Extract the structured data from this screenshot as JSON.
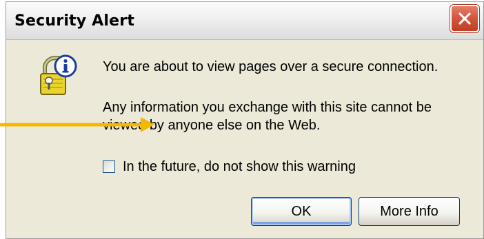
{
  "window": {
    "title": "Security Alert"
  },
  "dialog": {
    "message_primary": "You are about to view pages over a secure connection.",
    "message_secondary": "Any information you exchange with this site cannot be viewed by anyone else on the Web.",
    "checkbox": {
      "label": "In the future, do not show this warning",
      "checked": false
    },
    "buttons": {
      "ok_label": "OK",
      "more_info_label": "More Info"
    }
  },
  "icons": {
    "close": "close-icon",
    "alert": "security-info-lock-icon",
    "annotation": "arrow-icon"
  },
  "colors": {
    "dialog_background": "#ece9d8",
    "close_button": "#d4573e",
    "annotation_arrow": "#f5b800",
    "button_border": "#003c74"
  }
}
